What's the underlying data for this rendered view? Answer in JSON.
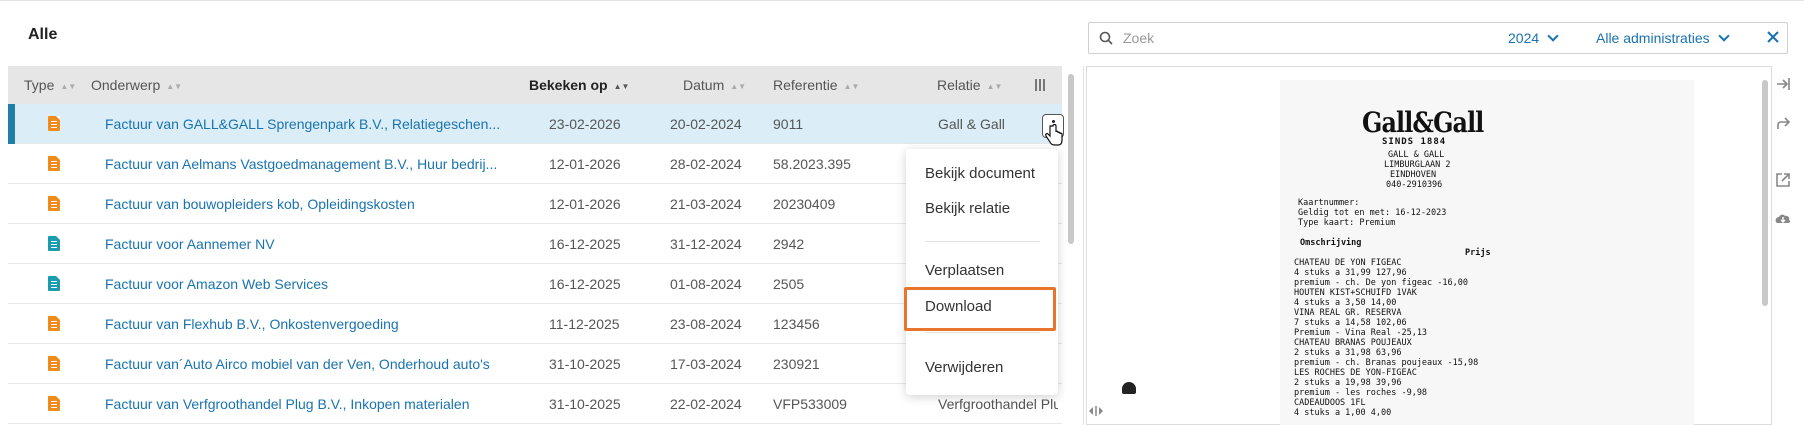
{
  "header": {
    "title": "Alle"
  },
  "table": {
    "columns": [
      {
        "label": "Type",
        "sort": "▲▼"
      },
      {
        "label": "Onderwerp",
        "sort": "▲▼"
      },
      {
        "label": "Bekeken op",
        "sort": "▲▼"
      },
      {
        "label": "Datum",
        "sort": "▲▼"
      },
      {
        "label": "Referentie",
        "sort": "▲▼"
      },
      {
        "label": "Relatie",
        "sort": "▲▼"
      }
    ],
    "rows": [
      {
        "icon": "invoice-icon",
        "icon_color": "#f08c1e",
        "subject": "Factuur van GALL&GALL Sprengenpark B.V., Relatiegeschen...",
        "viewed": "23-02-2026",
        "date": "20-02-2024",
        "reference": "9011",
        "relation": "Gall & Gall"
      },
      {
        "icon": "invoice-icon",
        "icon_color": "#f08c1e",
        "subject": "Factuur van Aelmans Vastgoedmanagement B.V., Huur bedrij...",
        "viewed": "12-01-2026",
        "date": "28-02-2024",
        "reference": "58.2023.395",
        "relation": ""
      },
      {
        "icon": "invoice-icon",
        "icon_color": "#f08c1e",
        "subject": "Factuur van bouwopleiders kob, Opleidingskosten",
        "viewed": "12-01-2026",
        "date": "21-03-2024",
        "reference": "20230409",
        "relation": ""
      },
      {
        "icon": "sales-invoice-icon",
        "icon_color": "#1a9bb0",
        "subject": "Factuur voor Aannemer NV",
        "viewed": "16-12-2025",
        "date": "31-12-2024",
        "reference": "2942",
        "relation": ""
      },
      {
        "icon": "sales-invoice-icon",
        "icon_color": "#1a9bb0",
        "subject": "Factuur voor Amazon Web Services",
        "viewed": "16-12-2025",
        "date": "01-08-2024",
        "reference": "2505",
        "relation": ""
      },
      {
        "icon": "invoice-icon",
        "icon_color": "#f08c1e",
        "subject": "Factuur van Flexhub B.V., Onkostenvergoeding",
        "viewed": "11-12-2025",
        "date": "23-08-2024",
        "reference": "123456",
        "relation": ""
      },
      {
        "icon": "invoice-icon",
        "icon_color": "#f08c1e",
        "subject": "Factuur van´Auto Airco mobiel van der Ven, Onderhoud auto's",
        "viewed": "31-10-2025",
        "date": "17-03-2024",
        "reference": "230921",
        "relation": ""
      },
      {
        "icon": "invoice-icon",
        "icon_color": "#f08c1e",
        "subject": "Factuur van Verfgroothandel Plug B.V., Inkopen materialen",
        "viewed": "31-10-2025",
        "date": "22-02-2024",
        "reference": "VFP533009",
        "relation": "Verfgroothandel Plu"
      }
    ]
  },
  "context_menu": {
    "items": [
      "Bekijk document",
      "Bekijk relatie",
      "Verplaatsen",
      "Download",
      "Verwijderen"
    ]
  },
  "search": {
    "placeholder": "Zoek",
    "year": "2024",
    "administration": "Alle administraties"
  },
  "receipt": {
    "logo": "Gall&Gall",
    "since": "SINDS 1884",
    "lines": [
      "GALL & GALL",
      "LIMBURGLAAN 2",
      "EINDHOVEN",
      "040-2910396",
      "Kaartnummer:",
      "Geldig tot en met: 16-12-2023",
      "Type kaart: Premium",
      "Omschrijving",
      "Prijs",
      "CHATEAU DE YON FIGEAC",
      "4 stuks a        31,99    127,96",
      "  premium - ch. De yon figeac  -16,00",
      "HOUTEN KIST+SCHUIFD 1VAK",
      "4 stuks a        3,50      14,00",
      "VINA REAL GR. RESERVA",
      "7 stuks a        14,58    102,06",
      "  Premium - Vina Real    -25,13",
      "CHATEAU BRANAS POUJEAUX",
      "2 stuks a        31,98     63,96",
      "  premium - ch. Branas poujeaux  -15,98",
      "LES ROCHES DE YON-FIGEAC",
      "2 stuks a        19,98     39,96",
      "  premium - les roches   -9,98",
      "CADEAUDOOS 1FL",
      "4 stuks a        1,00      4,00"
    ]
  }
}
